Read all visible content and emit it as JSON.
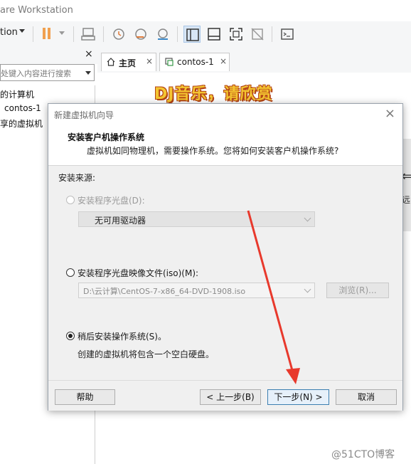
{
  "window": {
    "title": "are Workstation",
    "colors": {
      "accent": "#f0a050",
      "selection": "#d8e6f5"
    }
  },
  "toolbar": {
    "action_label": "tion",
    "icons": [
      "pause-icon",
      "send-keys-icon",
      "snapshot-icon",
      "revert-snapshot-icon",
      "manage-snapshots-icon",
      "library-view-icon",
      "thumbnail-view-icon",
      "fullscreen-icon",
      "unity-icon",
      "console-icon"
    ]
  },
  "library": {
    "close_label": "×",
    "search_placeholder": "处键入内容进行搜索",
    "items": [
      "的计算机",
      "contos-1",
      "享的虚拟机"
    ]
  },
  "tabs": [
    {
      "label": "主页",
      "close": "×"
    },
    {
      "label": "contos-1",
      "close": "×"
    }
  ],
  "content": {
    "banner": "DJ音乐，请欣赏",
    "right_partial_text": "远"
  },
  "dialog": {
    "title": "新建虚拟机向导",
    "close": "×",
    "header_title": "安装客户机操作系统",
    "header_desc": "虚拟机如同物理机，需要操作系统。您将如何安装客户机操作系统?",
    "source_label": "安装来源:",
    "options": {
      "disc": {
        "label": "安装程序光盘(D):",
        "enabled": false,
        "selected": false,
        "value": "无可用驱动器"
      },
      "iso": {
        "label": "安装程序光盘映像文件(iso)(M):",
        "enabled": true,
        "selected": false,
        "value": "D:\\云计算\\CentOS-7-x86_64-DVD-1908.iso",
        "browse_label": "浏览(R)..."
      },
      "later": {
        "label": "稍后安装操作系统(S)。",
        "enabled": true,
        "selected": true,
        "note": "创建的虚拟机将包含一个空白硬盘。"
      }
    },
    "buttons": {
      "help": "帮助",
      "back": "< 上一步(B)",
      "next": "下一步(N) >",
      "cancel": "取消"
    }
  },
  "watermark": "@51CTO博客"
}
